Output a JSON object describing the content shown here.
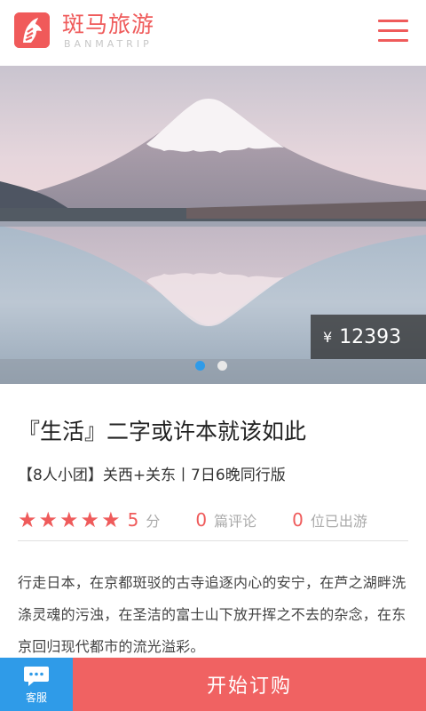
{
  "header": {
    "brand_name": "斑马旅游",
    "brand_sub": "BANMATRIP",
    "menu_icon": "menu-icon"
  },
  "banner": {
    "currency": "¥",
    "price": "12393",
    "slides": 2,
    "active_slide": 1
  },
  "tour": {
    "title": "『生活』二字或许本就该如此",
    "subtitle": "【8人小团】关西+关东丨7日6晚同行版",
    "rating": 5,
    "rating_value": "5",
    "rating_unit": "分",
    "reviews_count": "0",
    "reviews_label": "篇评论",
    "visited_count": "0",
    "visited_label": "位已出游",
    "description": "行走日本，在京都斑驳的古寺追逐内心的安宁，在芦之湖畔洗涤灵魂的污浊，在圣洁的富士山下放开挥之不去的杂念，在东京回归现代都市的流光溢彩。"
  },
  "bottom_bar": {
    "service_label": "客服",
    "book_label": "开始订购"
  },
  "colors": {
    "brand_red": "#ef5b5b",
    "service_blue": "#2f9be8"
  }
}
